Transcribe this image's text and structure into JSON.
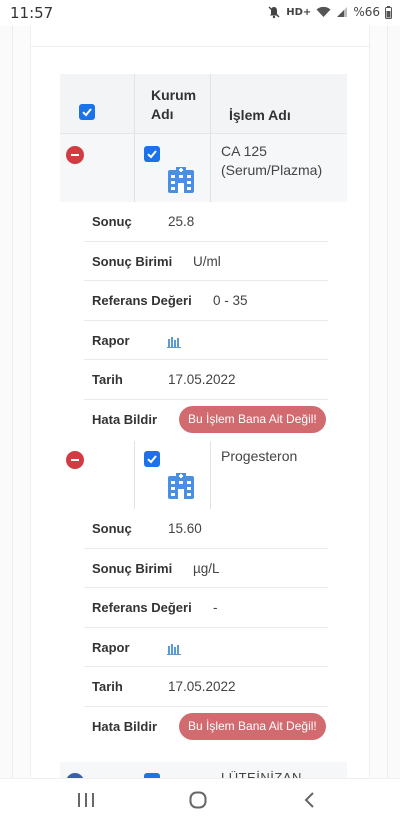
{
  "status_bar": {
    "time": "11:57",
    "network": "HD+",
    "battery": "%66"
  },
  "table": {
    "headers": {
      "kurum_line1": "Kurum",
      "kurum_line2": "Adı",
      "islem": "İşlem Adı"
    },
    "records": [
      {
        "islem_line1": "CA 125",
        "islem_line2": "(Serum/Plazma)",
        "sonuc_label": "Sonuç",
        "sonuc": "25.8",
        "birim_label": "Sonuç Birimi",
        "birim": "U/ml",
        "referans_label": "Referans Değeri",
        "referans": "0 - 35",
        "rapor_label": "Rapor",
        "tarih_label": "Tarih",
        "tarih": "17.05.2022",
        "hata_label": "Hata Bildir",
        "hata_button": "Bu İşlem Bana Ait Değil!"
      },
      {
        "islem_line1": "Progesteron",
        "islem_line2": "",
        "sonuc_label": "Sonuç",
        "sonuc": "15.60",
        "birim_label": "Sonuç Birimi",
        "birim": "µg/L",
        "referans_label": "Referans Değeri",
        "referans": "-",
        "rapor_label": "Rapor",
        "tarih_label": "Tarih",
        "tarih": "17.05.2022",
        "hata_label": "Hata Bildir",
        "hata_button": "Bu İşlem Bana Ait Değil!"
      }
    ],
    "next_row_peek": "LÜTEİNİZAN"
  },
  "colors": {
    "checkbox": "#1a73e8",
    "remove": "#d13c43",
    "error_button": "#d16b6f",
    "hospital_icon": "#4a90e2",
    "chart_icon": "#5b9bd5"
  },
  "icons": [
    "mute-icon",
    "wifi-icon",
    "signal-icon",
    "battery-icon",
    "hospital-icon",
    "bar-chart-icon",
    "recent-apps-icon",
    "home-icon",
    "back-icon"
  ]
}
